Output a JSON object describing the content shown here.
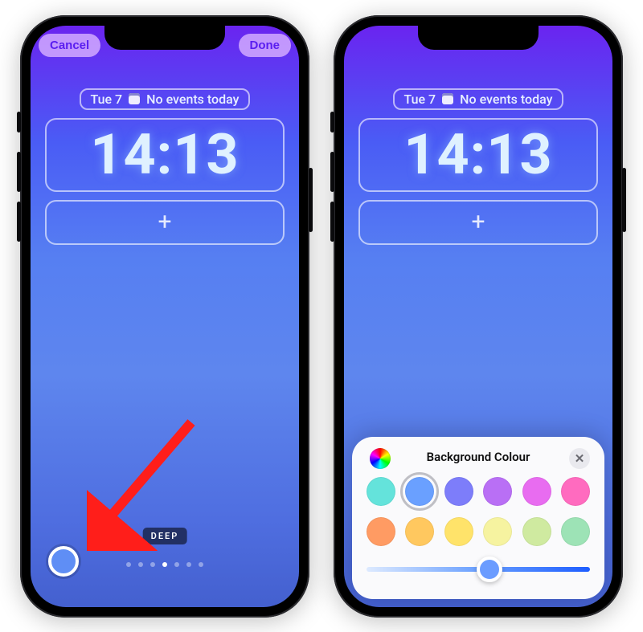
{
  "left": {
    "nav": {
      "cancel": "Cancel",
      "done": "Done"
    },
    "date": {
      "day": "Tue 7",
      "events": "No events today"
    },
    "time": "14:13",
    "effect_label": "DEEP",
    "page_dots": {
      "count": 7,
      "active_index": 3
    },
    "swatch_color": "#5f8ef5"
  },
  "right": {
    "date": {
      "day": "Tue 7",
      "events": "No events today"
    },
    "time": "14:13",
    "sheet": {
      "title": "Background Colour",
      "row1": [
        "#64e3db",
        "#6aa0ff",
        "#7d7dfa",
        "#b96ff5",
        "#e86cf0",
        "#ff6bbf"
      ],
      "row2": [
        "#ff9b63",
        "#ffc85f",
        "#ffe36a",
        "#f6f3a0",
        "#cfeaa0",
        "#9de3b6"
      ],
      "selected_index": 1,
      "slider_percent": 55
    }
  }
}
